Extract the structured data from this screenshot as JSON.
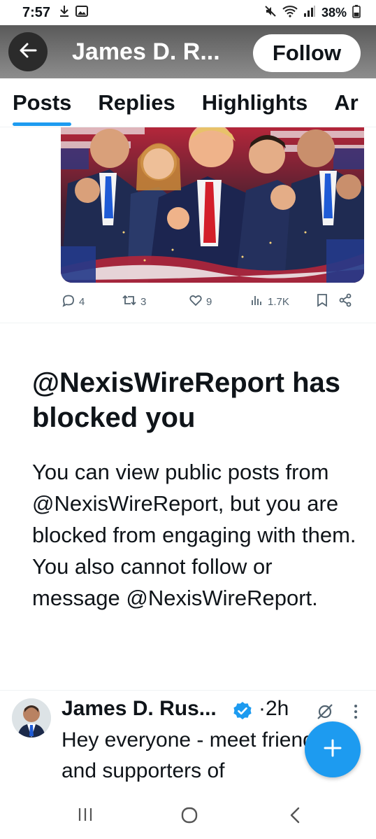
{
  "status_bar": {
    "time": "7:57",
    "battery": "38%"
  },
  "header": {
    "title": "James D. R...",
    "follow_label": "Follow"
  },
  "tabs": [
    {
      "label": "Posts",
      "active": true
    },
    {
      "label": "Replies",
      "active": false
    },
    {
      "label": "Highlights",
      "active": false
    },
    {
      "label": "Ar",
      "active": false
    }
  ],
  "post_actions": {
    "replies": "4",
    "reposts": "3",
    "likes": "9",
    "views": "1.7K"
  },
  "blocked_notice": {
    "title": "@NexisWireReport has blocked you",
    "body": "You can view public posts from @NexisWireReport, but you are blocked from engaging with them. You also cannot follow or message @NexisWireReport."
  },
  "tweet": {
    "author": "James D. Rus...",
    "separator": "·",
    "time": "2h",
    "text": "Hey everyone  -  meet friends and supporters of"
  },
  "colors": {
    "accent": "#1d9bf0",
    "text": "#0f1419",
    "muted": "#536471",
    "header_bg": "#6f6f6f"
  },
  "icons": [
    "download-icon",
    "image-icon",
    "mute-icon",
    "wifi-icon",
    "signal-icon",
    "battery-icon",
    "back-arrow-icon",
    "reply-icon",
    "repost-icon",
    "like-icon",
    "views-icon",
    "bookmark-icon",
    "share-icon",
    "verified-badge-icon",
    "grok-icon",
    "more-icon",
    "plus-icon",
    "recents-icon",
    "home-icon",
    "back-nav-icon"
  ]
}
